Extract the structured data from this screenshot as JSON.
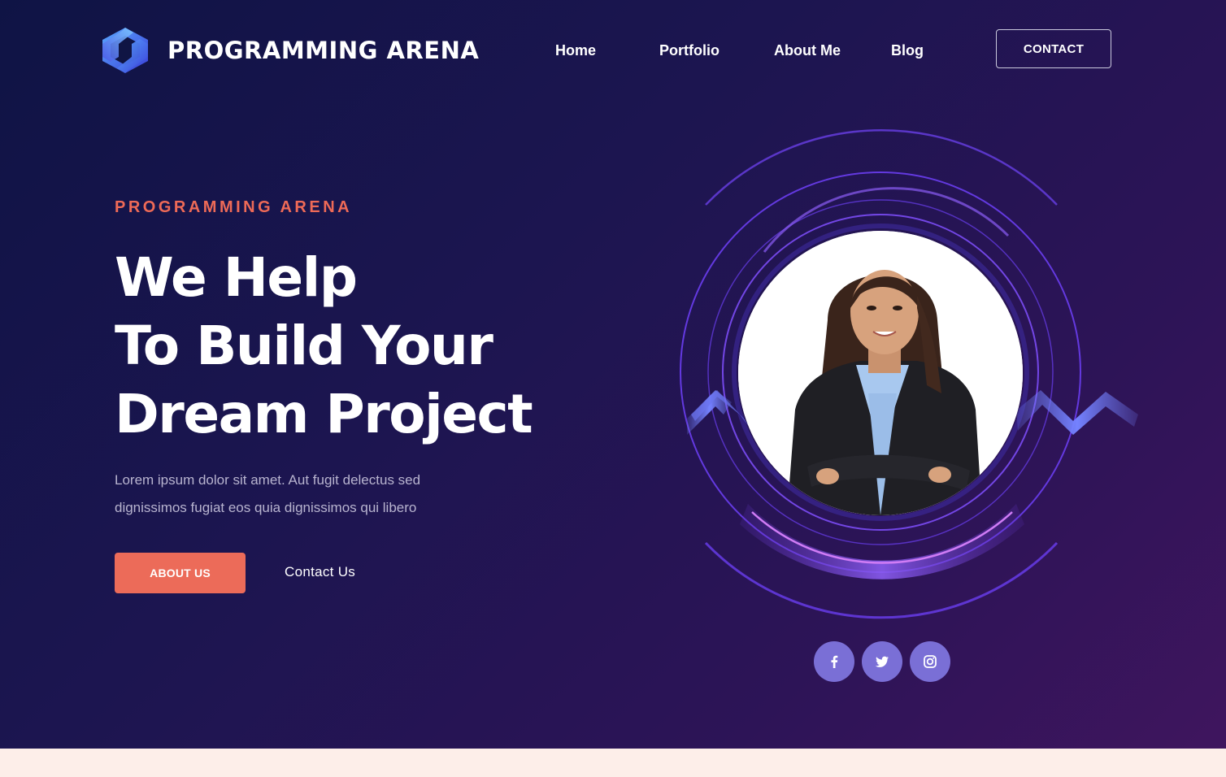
{
  "brand": {
    "name": "PROGRAMMING ARENA",
    "logo_icon": "hexagon-logo-icon"
  },
  "nav": {
    "items": [
      {
        "label": "Home"
      },
      {
        "label": "Portfolio"
      },
      {
        "label": "About Me"
      },
      {
        "label": "Blog"
      }
    ],
    "contact_label": "CONTACT"
  },
  "hero": {
    "eyebrow": "PROGRAMMING ARENA",
    "headline_lines": [
      "We Help",
      "To Build Your",
      "Dream Project"
    ],
    "description_lines": [
      "Lorem ipsum dolor sit amet. Aut fugit delectus sed",
      "dignissimos fugiat eos quia dignissimos qui libero"
    ],
    "primary_button": "ABOUT US",
    "secondary_link": "Contact Us"
  },
  "social": [
    {
      "icon": "facebook-icon"
    },
    {
      "icon": "twitter-icon"
    },
    {
      "icon": "instagram-icon"
    }
  ],
  "colors": {
    "accent": "#ec6b59",
    "eyebrow": "#ee6a57",
    "social_bg": "#7a6fd6",
    "ring": "#6a3df0",
    "background_start": "#0f1445",
    "background_end": "#3f155e",
    "bottom_strip": "#fdeee9"
  }
}
